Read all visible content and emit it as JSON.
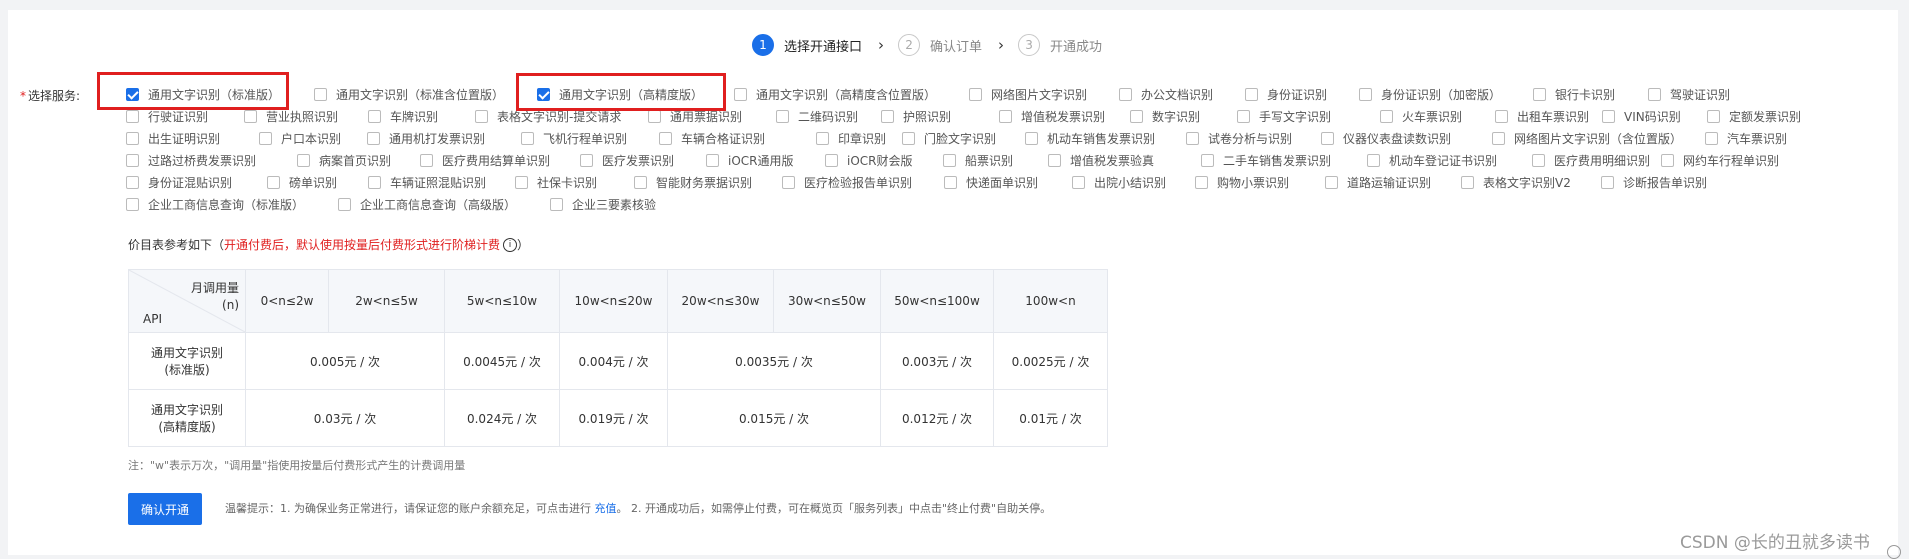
{
  "steps": [
    {
      "num": "1",
      "label": "选择开通接口"
    },
    {
      "num": "2",
      "label": "确认订单"
    },
    {
      "num": "3",
      "label": "开通成功"
    }
  ],
  "service_label": {
    "required_mark": "*",
    "text": "选择服务:"
  },
  "services": [
    {
      "label": "通用文字识别（标准版）",
      "checked": true
    },
    {
      "label": "通用文字识别（标准含位置版）",
      "checked": false
    },
    {
      "label": "通用文字识别（高精度版）",
      "checked": true
    },
    {
      "label": "通用文字识别（高精度含位置版）",
      "checked": false
    },
    {
      "label": "网络图片文字识别",
      "checked": false
    },
    {
      "label": "办公文档识别",
      "checked": false
    },
    {
      "label": "身份证识别",
      "checked": false
    },
    {
      "label": "身份证识别（加密版）",
      "checked": false
    },
    {
      "label": "银行卡识别",
      "checked": false
    },
    {
      "label": "驾驶证识别",
      "checked": false
    },
    {
      "label": "行驶证识别",
      "checked": false
    },
    {
      "label": "营业执照识别",
      "checked": false
    },
    {
      "label": "车牌识别",
      "checked": false
    },
    {
      "label": "表格文字识别-提交请求",
      "checked": false
    },
    {
      "label": "通用票据识别",
      "checked": false
    },
    {
      "label": "二维码识别",
      "checked": false
    },
    {
      "label": "护照识别",
      "checked": false
    },
    {
      "label": "增值税发票识别",
      "checked": false
    },
    {
      "label": "数字识别",
      "checked": false
    },
    {
      "label": "手写文字识别",
      "checked": false
    },
    {
      "label": "火车票识别",
      "checked": false
    },
    {
      "label": "出租车票识别",
      "checked": false
    },
    {
      "label": "VIN码识别",
      "checked": false
    },
    {
      "label": "定额发票识别",
      "checked": false
    },
    {
      "label": "出生证明识别",
      "checked": false
    },
    {
      "label": "户口本识别",
      "checked": false
    },
    {
      "label": "通用机打发票识别",
      "checked": false
    },
    {
      "label": "飞机行程单识别",
      "checked": false
    },
    {
      "label": "车辆合格证识别",
      "checked": false
    },
    {
      "label": "印章识别",
      "checked": false
    },
    {
      "label": "门脸文字识别",
      "checked": false
    },
    {
      "label": "机动车销售发票识别",
      "checked": false
    },
    {
      "label": "试卷分析与识别",
      "checked": false
    },
    {
      "label": "仪器仪表盘读数识别",
      "checked": false
    },
    {
      "label": "网络图片文字识别（含位置版）",
      "checked": false
    },
    {
      "label": "汽车票识别",
      "checked": false
    },
    {
      "label": "过路过桥费发票识别",
      "checked": false
    },
    {
      "label": "病案首页识别",
      "checked": false
    },
    {
      "label": "医疗费用结算单识别",
      "checked": false
    },
    {
      "label": "医疗发票识别",
      "checked": false
    },
    {
      "label": "iOCR通用版",
      "checked": false
    },
    {
      "label": "iOCR财会版",
      "checked": false
    },
    {
      "label": "船票识别",
      "checked": false
    },
    {
      "label": "增值税发票验真",
      "checked": false
    },
    {
      "label": "二手车销售发票识别",
      "checked": false
    },
    {
      "label": "机动车登记证书识别",
      "checked": false
    },
    {
      "label": "医疗费用明细识别",
      "checked": false
    },
    {
      "label": "网约车行程单识别",
      "checked": false
    },
    {
      "label": "身份证混贴识别",
      "checked": false
    },
    {
      "label": "磅单识别",
      "checked": false
    },
    {
      "label": "车辆证照混贴识别",
      "checked": false
    },
    {
      "label": "社保卡识别",
      "checked": false
    },
    {
      "label": "智能财务票据识别",
      "checked": false
    },
    {
      "label": "医疗检验报告单识别",
      "checked": false
    },
    {
      "label": "快递面单识别",
      "checked": false
    },
    {
      "label": "出院小结识别",
      "checked": false
    },
    {
      "label": "购物小票识别",
      "checked": false
    },
    {
      "label": "道路运输证识别",
      "checked": false
    },
    {
      "label": "表格文字识别V2",
      "checked": false
    },
    {
      "label": "诊断报告单识别",
      "checked": false
    },
    {
      "label": "企业工商信息查询（标准版）",
      "checked": false
    },
    {
      "label": "企业工商信息查询（高级版）",
      "checked": false
    },
    {
      "label": "企业三要素核验",
      "checked": false
    }
  ],
  "price": {
    "caption_prefix": "价目表参考如下（",
    "caption_red": "开通付费后，默认使用按量后付费形式进行阶梯计费",
    "caption_icon": "i",
    "caption_suffix": "）",
    "header_corner_top": "月调用量",
    "header_corner_unit": "(n)",
    "header_corner_bottom": "API",
    "columns": [
      "0<n≤2w",
      "2w<n≤5w",
      "5w<n≤10w",
      "10w<n≤20w",
      "20w<n≤30w",
      "30w<n≤50w",
      "50w<n≤100w",
      "100w<n"
    ],
    "rows": [
      {
        "api_line1": "通用文字识别",
        "api_line2": "(标准版)",
        "c1": "0.005元 / 次",
        "c2": "0.0045元 / 次",
        "c3": "0.004元 / 次",
        "c4": "0.0035元 / 次",
        "c5": "0.003元 / 次",
        "c6": "0.0025元 / 次"
      },
      {
        "api_line1": "通用文字识别",
        "api_line2": "(高精度版)",
        "c1": "0.03元 / 次",
        "c2": "0.024元 / 次",
        "c3": "0.019元 / 次",
        "c4": "0.015元 / 次",
        "c5": "0.012元 / 次",
        "c6": "0.01元 / 次"
      }
    ]
  },
  "note": "注：\"w\"表示万次，\"调用量\"指使用按量后付费形式产生的计费调用量",
  "confirm_button": "确认开通",
  "tip": {
    "prefix": "温馨提示：1. 为确保业务正常进行，请保证您的账户余额充足，可点击进行",
    "link": "充值",
    "suffix": "。 2. 开通成功后，如需停止付费，可在概览页「服务列表」中点击\"终止付费\"自助关停。"
  },
  "watermark": "CSDN @长的丑就多读书"
}
